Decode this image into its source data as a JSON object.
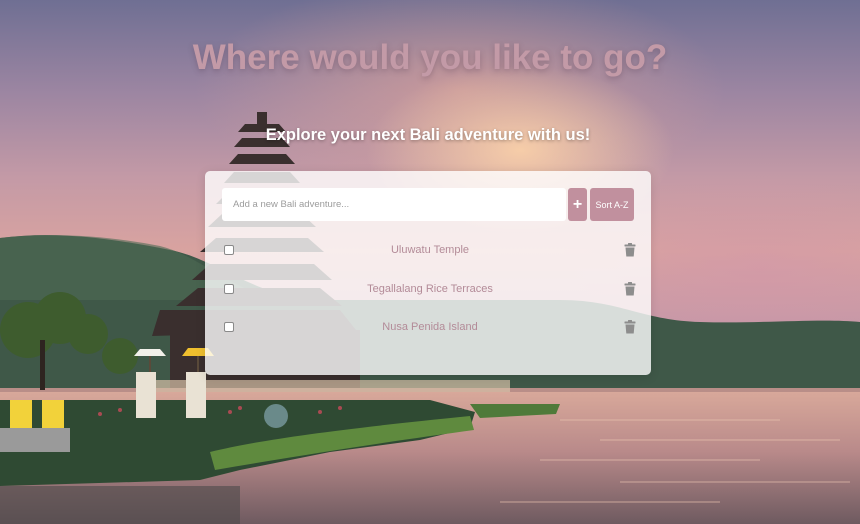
{
  "hero": {
    "title": "Where would you like to go?",
    "subtitle": "Explore your next Bali adventure with us!"
  },
  "form": {
    "input_value": "",
    "input_placeholder": "Add a new Bali adventure...",
    "add_label": "+",
    "sort_label": "Sort A-Z"
  },
  "adventures": [
    {
      "name": "Uluwatu Temple",
      "checked": false
    },
    {
      "name": "Tegallalang Rice Terraces",
      "checked": false
    },
    {
      "name": "Nusa Penida Island",
      "checked": false
    }
  ],
  "icons": {
    "delete": "trash-icon"
  },
  "colors": {
    "accent": "#c1909e",
    "title": "#c39aa7",
    "item_text": "#b38b98",
    "card_bg": "rgba(255,255,255,0.80)"
  }
}
